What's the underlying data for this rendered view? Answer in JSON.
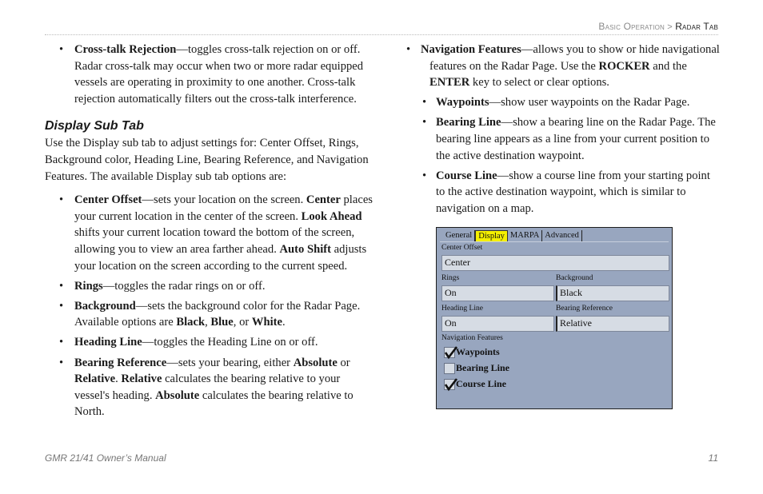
{
  "header": {
    "section": "Basic Operation",
    "separator": ">",
    "current": "Radar Tab"
  },
  "left_column": {
    "crosstalk": {
      "term": "Cross-talk Rejection",
      "text": "—toggles cross-talk rejection on or off. Radar cross-talk may occur when two or more radar equipped vessels are operating in proximity to one another. Cross-talk rejection automatically filters out the cross-talk interference."
    },
    "heading": "Display Sub Tab",
    "intro": "Use the Display sub tab to adjust settings for: Center Offset, Rings, Background color, Heading Line, Bearing Reference, and Navigation Features. The available Display sub tab options are:",
    "center_offset": {
      "term": "Center Offset",
      "t1": "—sets your location on the screen. ",
      "b1": "Center",
      "t2": " places your current location in the center of the screen. ",
      "b2": "Look Ahead",
      "t3": " shifts your current location toward the bottom of the screen, allowing you to view an area farther ahead. ",
      "b3": "Auto Shift",
      "t4": " adjusts your location on the screen according to the current speed."
    },
    "rings": {
      "term": "Rings",
      "text": "—toggles the radar rings on or off."
    },
    "background": {
      "term": "Background",
      "t1": "—sets the background color for the Radar Page. Available options are ",
      "b1": "Black",
      "t2": ", ",
      "b2": "Blue",
      "t3": ", or ",
      "b3": "White",
      "t4": "."
    },
    "heading_line": {
      "term": "Heading Line",
      "text": "—toggles the Heading Line on or off."
    },
    "bearing_reference": {
      "term": "Bearing Reference",
      "t1": "—sets your bearing, either ",
      "b1": "Absolute",
      "t2": " or ",
      "b2": "Relative",
      "t3": ". ",
      "b3": "Relative",
      "t4": " calculates the bearing relative to your vessel's heading. ",
      "b4": "Absolute",
      "t5": " calculates the bearing relative to North."
    }
  },
  "right_column": {
    "nav_features": {
      "term": "Navigation Features",
      "t1": "—allows you to show or hide navigational features on the Radar Page. Use the ",
      "b1": "ROCKER",
      "t2": " and the ",
      "b2": "ENTER",
      "t3": " key to select or clear options."
    },
    "waypoints": {
      "term": "Waypoints",
      "text": "—show user waypoints on the Radar Page."
    },
    "bearing_line": {
      "term": "Bearing Line",
      "text": "—show a bearing line on the Radar Page. The bearing line appears as a line from your current position to the active destination waypoint."
    },
    "course_line": {
      "term": "Course Line",
      "text": "—show a course line from your starting point to the active destination waypoint, which is similar to navigation on a map."
    }
  },
  "device": {
    "tabs": [
      "General",
      "Display",
      "MARPA",
      "Advanced"
    ],
    "active_tab": "Display",
    "center_offset_label": "Center Offset",
    "center_offset_value": "Center",
    "rings_label": "Rings",
    "rings_value": "On",
    "background_label": "Background",
    "background_value": "Black",
    "heading_line_label": "Heading Line",
    "heading_line_value": "On",
    "bearing_ref_label": "Bearing Reference",
    "bearing_ref_value": "Relative",
    "nav_features_label": "Navigation Features",
    "checks": [
      {
        "label": "Waypoints",
        "checked": true
      },
      {
        "label": "Bearing Line",
        "checked": false
      },
      {
        "label": "Course Line",
        "checked": true
      }
    ],
    "colors": {
      "panel": "#98a6bf",
      "field": "#d6dce4",
      "active_tab": "#f5f000"
    }
  },
  "footer": {
    "manual": "GMR 21/41 Owner’s Manual",
    "page": "11"
  }
}
